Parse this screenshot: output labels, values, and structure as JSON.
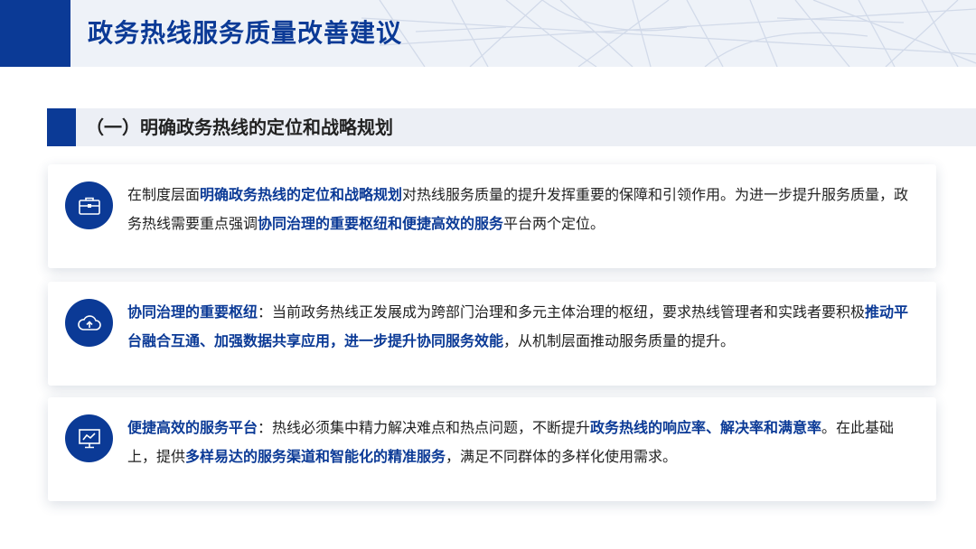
{
  "header": {
    "title": "政务热线服务质量改善建议"
  },
  "section": {
    "title": "（一）明确政务热线的定位和战略规划"
  },
  "cards": [
    {
      "icon": "briefcase-icon",
      "segments": [
        "在制度层面",
        "明确政务热线的定位和战略规划",
        "对热线服务质量的提升发挥重要的保障和引领作用。为进一步提升服务质量，政务热线需要重点强调",
        "协同治理的重要枢纽和便捷高效的服务",
        "平台两个定位。"
      ]
    },
    {
      "icon": "cloud-upload-icon",
      "segments": [
        "协同治理的重要枢纽",
        "：当前政务热线正发展成为跨部门治理和多元主体治理的枢纽，要求热线管理者和实践者要积极",
        "推动平台融合互通、加强数据共享应用，进一步提升协同服务效能",
        "，从机制层面推动服务质量的提升。"
      ]
    },
    {
      "icon": "monitor-chart-icon",
      "segments": [
        "便捷高效的服务平台",
        "：热线必须集中精力解决难点和热点问题，不断提升",
        "政务热线的响应率、解决率和满意率",
        "。在此基础上，提供",
        "多样易达的服务渠道和智能化的精准服务",
        "，满足不同群体的多样化使用需求。"
      ]
    }
  ],
  "colors": {
    "primary": "#0b3a96",
    "text": "#222222",
    "header_bg": "#eef2f8"
  }
}
